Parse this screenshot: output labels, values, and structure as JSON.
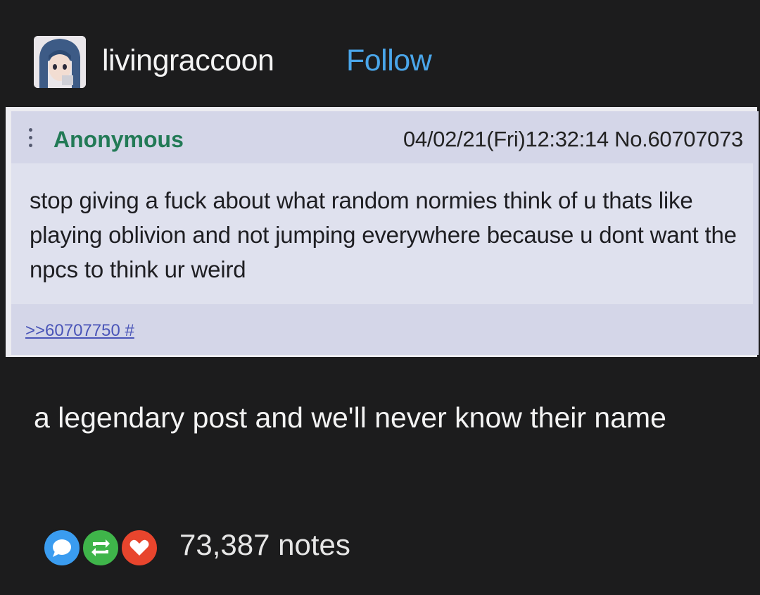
{
  "header": {
    "username": "livingraccoon",
    "follow_label": "Follow"
  },
  "post": {
    "author": "Anonymous",
    "meta": "04/02/21(Fri)12:32:14 No.60707073",
    "body": "stop giving a fuck about what random normies think of u thats like playing oblivion and not jumping everywhere because u dont want the npcs to think ur weird",
    "reply_link": ">>60707750 #"
  },
  "caption": "a legendary post and we'll never know their name",
  "footer": {
    "reaction_icons": [
      "reply-bubble-icon",
      "reblog-icon",
      "like-heart-icon"
    ],
    "notes": "73,387 notes"
  },
  "colors": {
    "follow": "#4aa6ea",
    "anon_name": "#227a56",
    "reply_bubble": "#3a9cf0",
    "reblog": "#3fb54a",
    "like": "#e8452d"
  }
}
